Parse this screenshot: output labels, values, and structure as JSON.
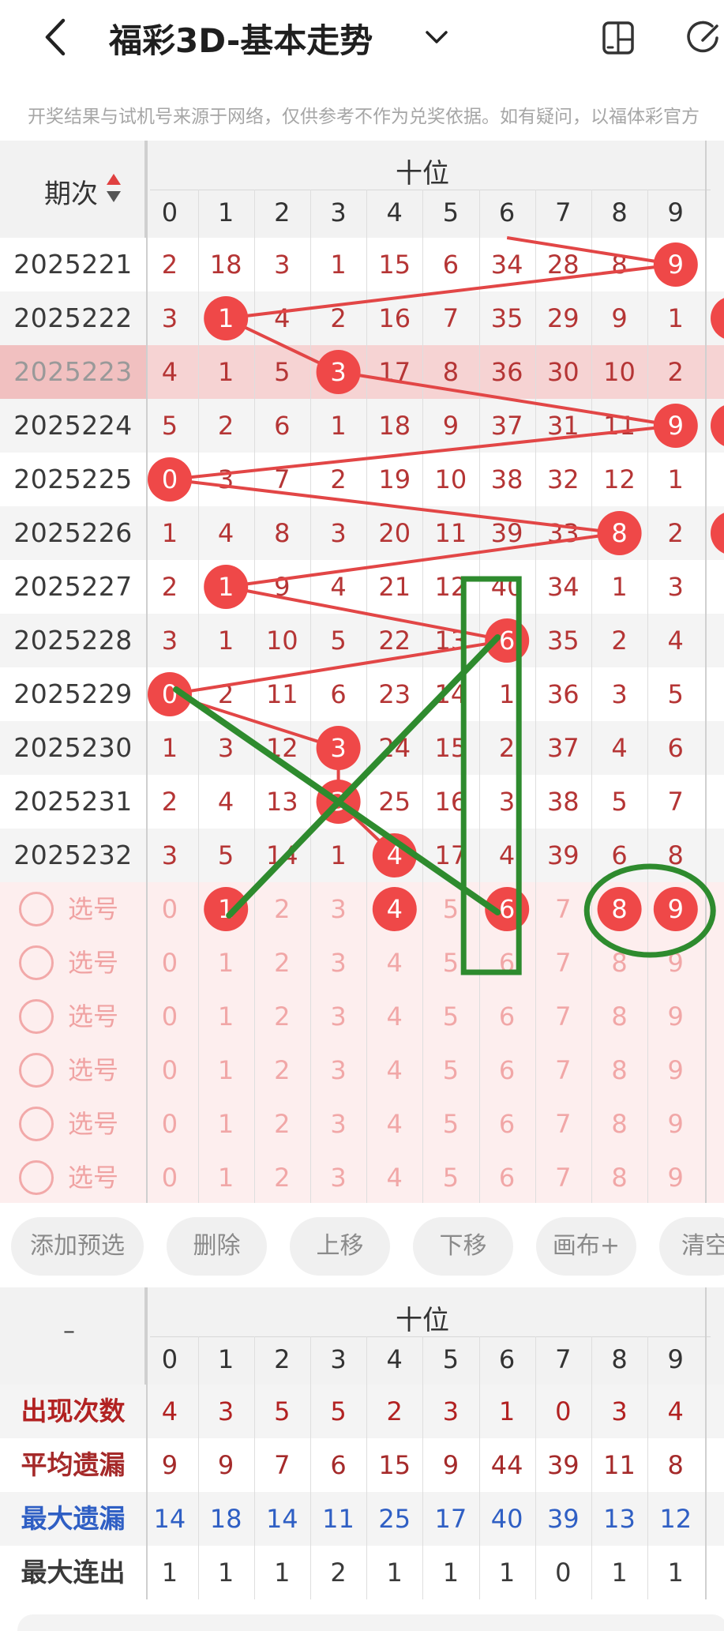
{
  "header": {
    "title": "福彩3D-基本走势",
    "back_icon": "back-arrow-icon",
    "dropdown_icon": "chevron-down-icon",
    "icon_a": "phone-split-icon",
    "icon_b": "refresh-icon"
  },
  "notice": "开奖结果与试机号来源于网络，仅供参考不作为兑奖依据。如有疑问，以福体彩官方",
  "trend": {
    "group_title": "十位",
    "issue_header": "期次",
    "digits": [
      "0",
      "1",
      "2",
      "3",
      "4",
      "5",
      "6",
      "7",
      "8",
      "9"
    ],
    "rows": [
      {
        "issue": "2025221",
        "cells": [
          "2",
          "18",
          "3",
          "1",
          "15",
          "6",
          "34",
          "28",
          "8",
          "9"
        ]
      },
      {
        "issue": "2025222",
        "cells": [
          "3",
          "1",
          "4",
          "2",
          "16",
          "7",
          "35",
          "29",
          "9",
          "1"
        ]
      },
      {
        "issue": "2025223",
        "cells": [
          "4",
          "1",
          "5",
          "3",
          "17",
          "8",
          "36",
          "30",
          "10",
          "2"
        ]
      },
      {
        "issue": "2025224",
        "cells": [
          "5",
          "2",
          "6",
          "1",
          "18",
          "9",
          "37",
          "31",
          "11",
          "9"
        ]
      },
      {
        "issue": "2025225",
        "cells": [
          "0",
          "3",
          "7",
          "2",
          "19",
          "10",
          "38",
          "32",
          "12",
          "1"
        ]
      },
      {
        "issue": "2025226",
        "cells": [
          "1",
          "4",
          "8",
          "3",
          "20",
          "11",
          "39",
          "33",
          "8",
          "2"
        ]
      },
      {
        "issue": "2025227",
        "cells": [
          "2",
          "1",
          "9",
          "4",
          "21",
          "12",
          "40",
          "34",
          "1",
          "3"
        ]
      },
      {
        "issue": "2025228",
        "cells": [
          "3",
          "1",
          "10",
          "5",
          "22",
          "13",
          "6",
          "35",
          "2",
          "4"
        ]
      },
      {
        "issue": "2025229",
        "cells": [
          "0",
          "2",
          "11",
          "6",
          "23",
          "14",
          "1",
          "36",
          "3",
          "5"
        ]
      },
      {
        "issue": "2025230",
        "cells": [
          "1",
          "3",
          "12",
          "3",
          "24",
          "15",
          "2",
          "37",
          "4",
          "6"
        ]
      },
      {
        "issue": "2025231",
        "cells": [
          "2",
          "4",
          "13",
          "3",
          "25",
          "16",
          "3",
          "38",
          "5",
          "7"
        ]
      },
      {
        "issue": "2025232",
        "cells": [
          "3",
          "5",
          "14",
          "1",
          "4",
          "17",
          "4",
          "39",
          "6",
          "8"
        ]
      }
    ],
    "winning_cols": [
      9,
      1,
      3,
      9,
      0,
      8,
      1,
      6,
      0,
      3,
      3,
      4
    ],
    "select_label": "选号",
    "select_rows": [
      {
        "nums": [
          "0",
          "1",
          "2",
          "3",
          "4",
          "5",
          "6",
          "7",
          "8",
          "9"
        ],
        "picked": [
          1,
          4,
          6,
          8,
          9
        ]
      },
      {
        "nums": [
          "0",
          "1",
          "2",
          "3",
          "4",
          "5",
          "6",
          "7",
          "8",
          "9"
        ],
        "picked": []
      },
      {
        "nums": [
          "0",
          "1",
          "2",
          "3",
          "4",
          "5",
          "6",
          "7",
          "8",
          "9"
        ],
        "picked": []
      },
      {
        "nums": [
          "0",
          "1",
          "2",
          "3",
          "4",
          "5",
          "6",
          "7",
          "8",
          "9"
        ],
        "picked": []
      },
      {
        "nums": [
          "0",
          "1",
          "2",
          "3",
          "4",
          "5",
          "6",
          "7",
          "8",
          "9"
        ],
        "picked": []
      },
      {
        "nums": [
          "0",
          "1",
          "2",
          "3",
          "4",
          "5",
          "6",
          "7",
          "8",
          "9"
        ],
        "picked": []
      }
    ]
  },
  "toolbar": {
    "buttons": [
      "添加预选",
      "删除",
      "上移",
      "下移",
      "画布+",
      "清空"
    ]
  },
  "stats": {
    "group_title": "十位",
    "corner": "–",
    "digits": [
      "0",
      "1",
      "2",
      "3",
      "4",
      "5",
      "6",
      "7",
      "8",
      "9"
    ],
    "rows": [
      {
        "label": "出现次数",
        "color": "#b22222",
        "values": [
          "4",
          "3",
          "5",
          "5",
          "2",
          "3",
          "1",
          "0",
          "3",
          "4"
        ]
      },
      {
        "label": "平均遗漏",
        "color": "#a52a2a",
        "values": [
          "9",
          "9",
          "7",
          "6",
          "15",
          "9",
          "44",
          "39",
          "11",
          "8"
        ]
      },
      {
        "label": "最大遗漏",
        "color": "#2f5fc4",
        "values": [
          "14",
          "18",
          "14",
          "11",
          "25",
          "17",
          "40",
          "39",
          "13",
          "12"
        ]
      },
      {
        "label": "最大连出",
        "color": "#3a3a3a",
        "values": [
          "1",
          "1",
          "1",
          "2",
          "1",
          "1",
          "1",
          "0",
          "1",
          "1"
        ]
      }
    ]
  },
  "colors": {
    "ball": "#ef4848",
    "line": "#e24646",
    "annotation": "#2e8b2e",
    "highlight_row": "#f6d3d3",
    "select_bg": "#fdeeee"
  }
}
